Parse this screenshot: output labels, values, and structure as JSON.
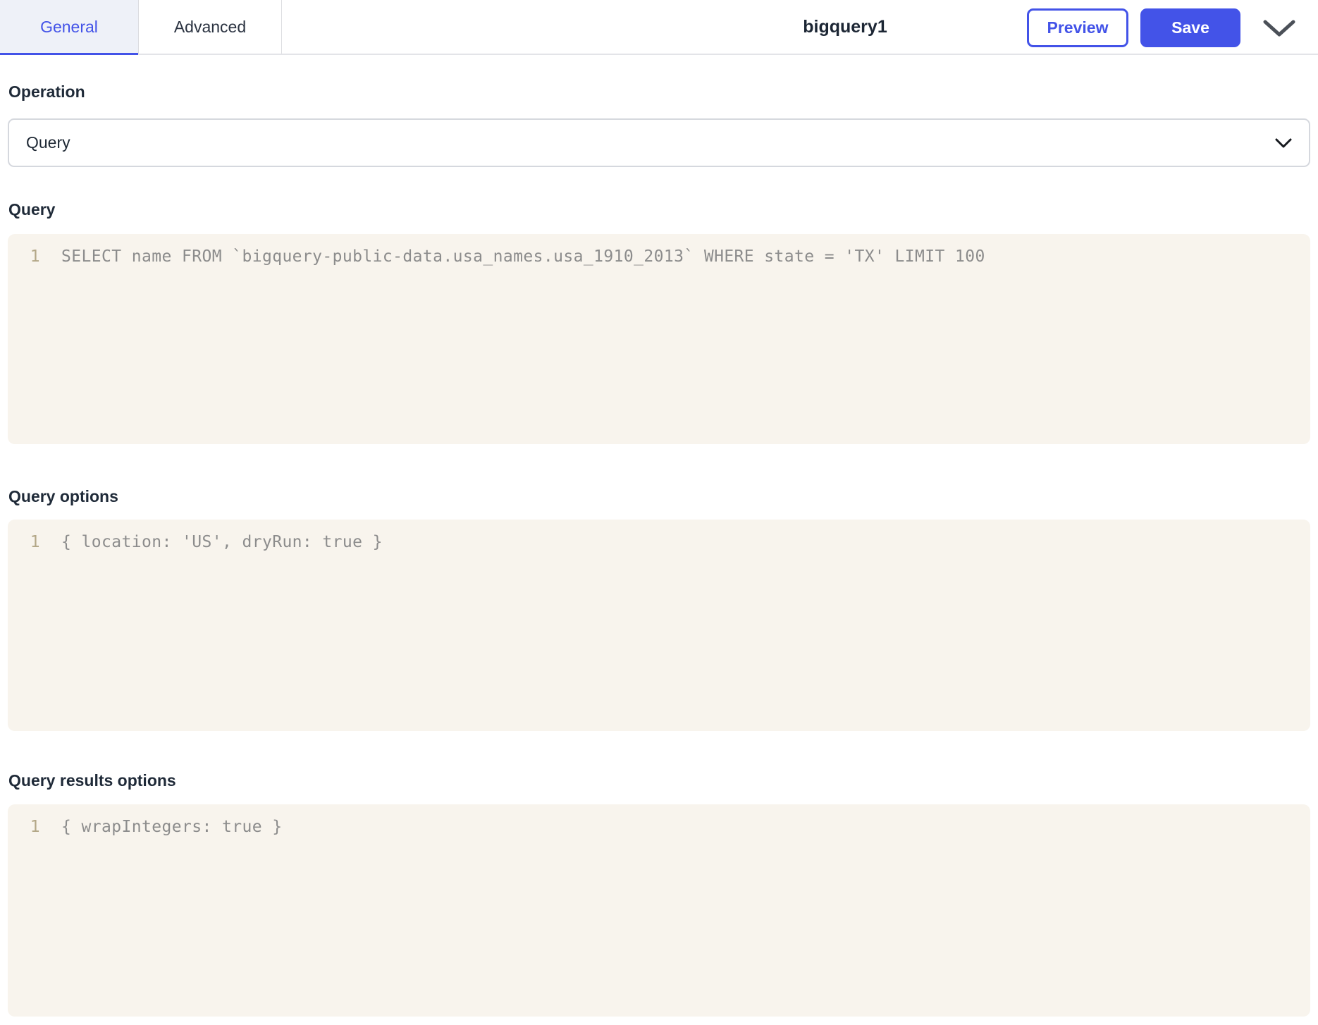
{
  "header": {
    "tabs": [
      {
        "label": "General",
        "active": true
      },
      {
        "label": "Advanced",
        "active": false
      }
    ],
    "title": "bigquery1",
    "buttons": {
      "preview": "Preview",
      "save": "Save"
    },
    "menu_icon": "chevron-down"
  },
  "form": {
    "operation": {
      "label": "Operation",
      "selected_value": "Query"
    },
    "query": {
      "label": "Query",
      "lines": [
        {
          "number": "1",
          "code": "SELECT name FROM `bigquery-public-data.usa_names.usa_1910_2013` WHERE state = 'TX' LIMIT 100"
        }
      ]
    },
    "query_options": {
      "label": "Query options",
      "lines": [
        {
          "number": "1",
          "code": "{ location: 'US', dryRun: true }"
        }
      ]
    },
    "query_results_options": {
      "label": "Query results options",
      "lines": [
        {
          "number": "1",
          "code": "{ wrapIntegers: true }"
        }
      ]
    }
  },
  "colors": {
    "accent": "#4353e8",
    "active_tab_background": "#eef1f8",
    "editor_background": "#f8f4ed",
    "line_number": "#b3a787",
    "code_text": "#8c8c8c",
    "heading_text": "#1f2a38"
  }
}
